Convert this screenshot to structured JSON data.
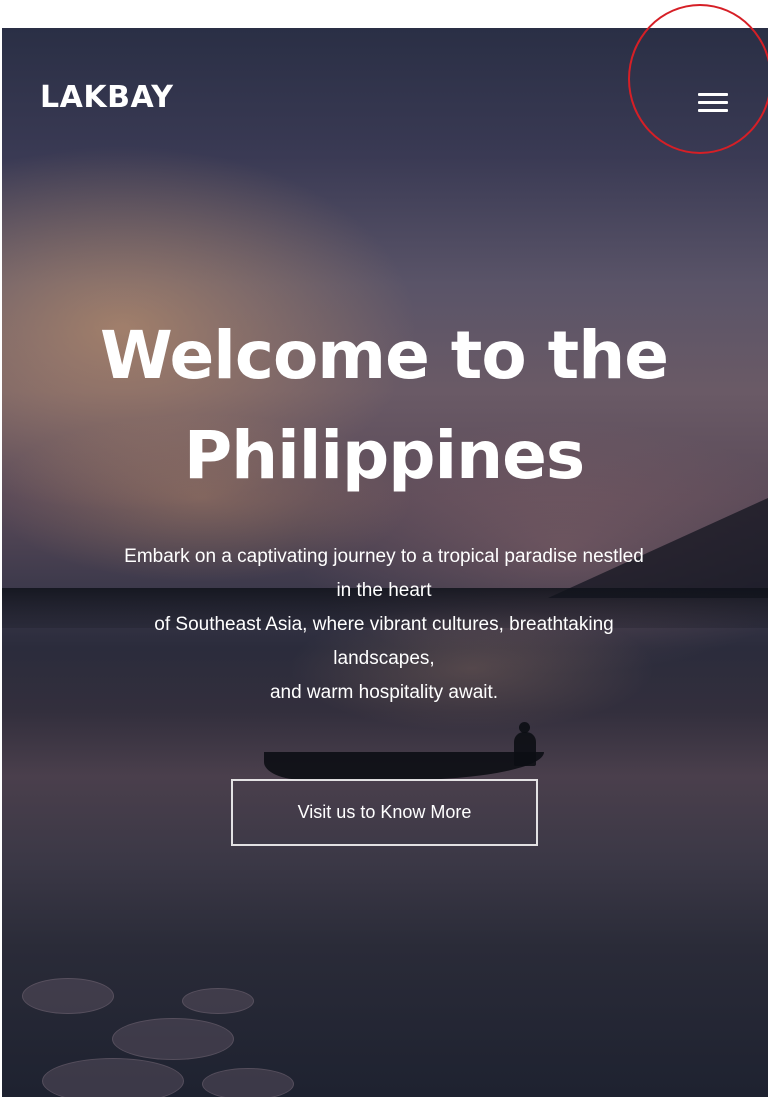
{
  "header": {
    "logo_text": "LAKBAY",
    "menu_icon": "hamburger-menu-icon"
  },
  "hero": {
    "title_line1": "Welcome to the",
    "title_line2": "Philippines",
    "description_lines": [
      "Embark on a captivating journey to a tropical paradise nestled",
      "in the heart",
      "of Southeast Asia, where vibrant cultures, breathtaking",
      "landscapes,",
      "and warm hospitality await."
    ],
    "cta_label": "Visit us to Know More"
  },
  "colors": {
    "text": "#ffffff",
    "annotation": "#d61f26"
  }
}
